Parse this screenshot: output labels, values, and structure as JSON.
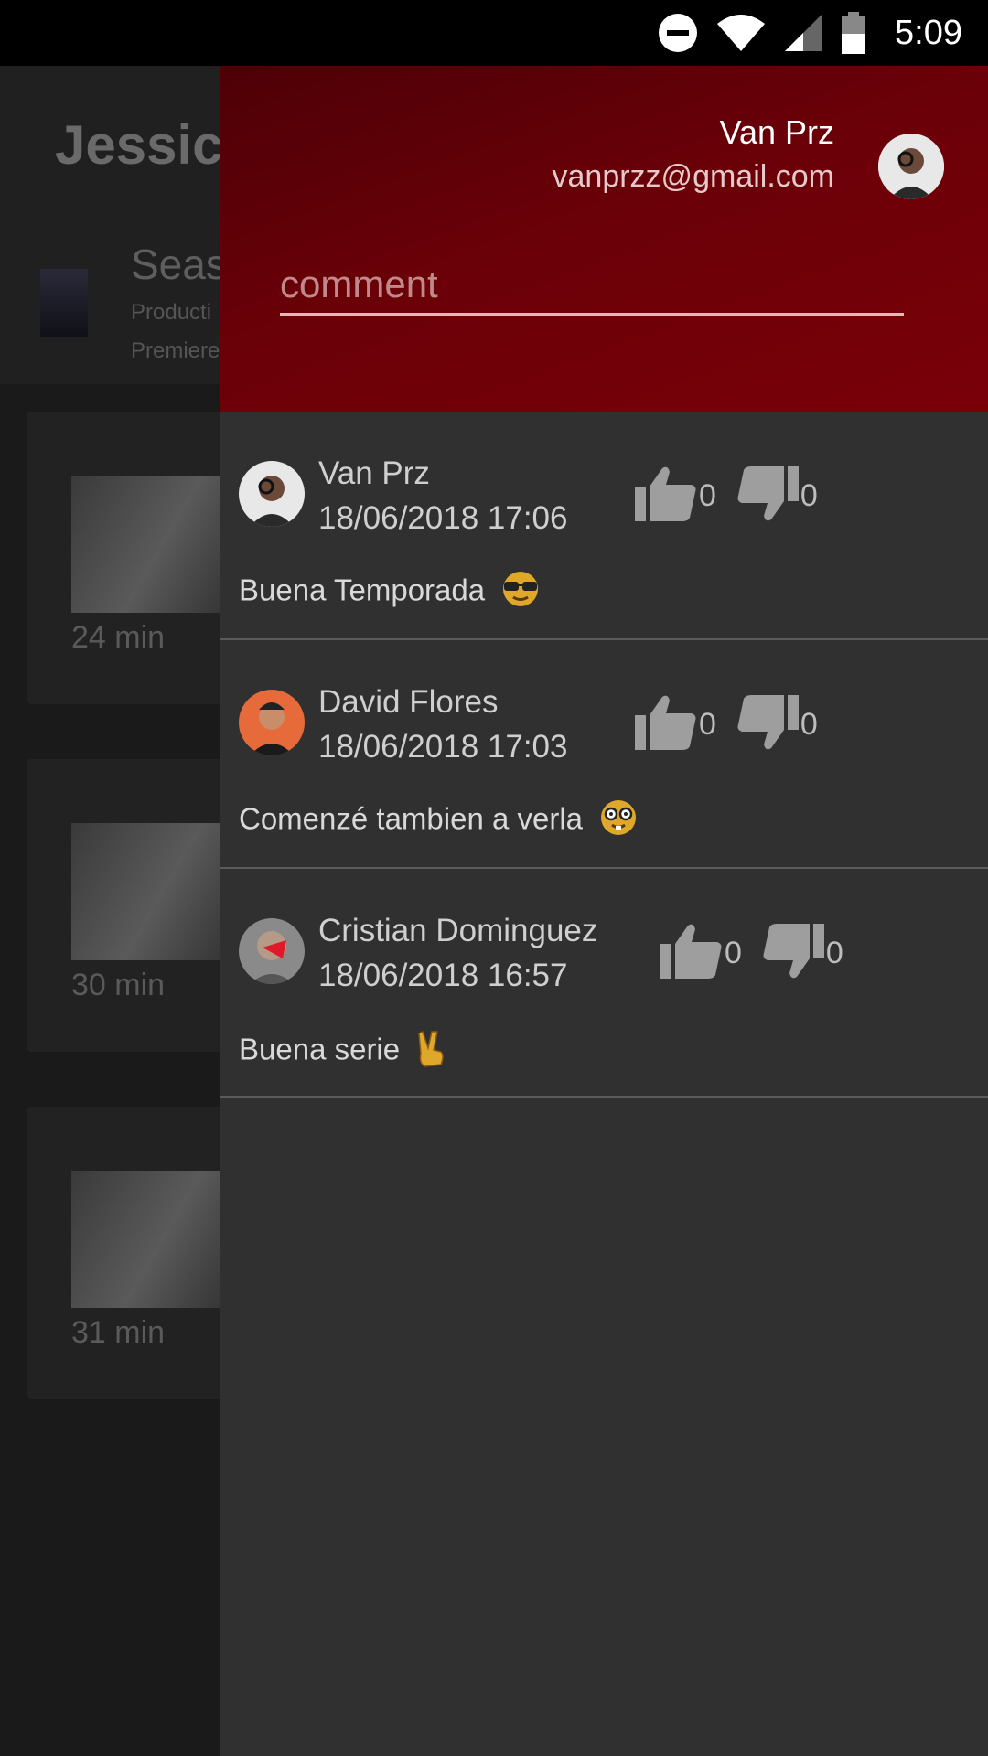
{
  "status_bar": {
    "time": "5:09"
  },
  "background_page": {
    "title": "Jessica",
    "season_label": "Seas",
    "season_line1": "Producti",
    "season_line2": "Premiere",
    "episodes": [
      {
        "duration": "24 min"
      },
      {
        "duration": "30 min"
      },
      {
        "duration": "31 min"
      }
    ]
  },
  "drawer": {
    "user": {
      "name": "Van Prz",
      "email": "vanprzz@gmail.com"
    },
    "comment_input": {
      "placeholder": "comment",
      "value": ""
    },
    "comments": [
      {
        "author": "Van Prz",
        "date": "18/06/2018 17:06",
        "text": "Buena Temporada",
        "emoji": "sunglasses",
        "likes": "0",
        "dislikes": "0"
      },
      {
        "author": "David Flores",
        "date": "18/06/2018 17:03",
        "text": "Comenzé tambien a verla",
        "emoji": "nerd-face",
        "likes": "0",
        "dislikes": "0"
      },
      {
        "author": "Cristian Dominguez",
        "date": "18/06/2018 16:57",
        "text": "Buena serie",
        "emoji": "victory-hand",
        "likes": "0",
        "dislikes": "0"
      }
    ]
  },
  "colors": {
    "header_red": "#6a0008",
    "drawer_bg": "#303030",
    "divider": "#5a5a5a"
  }
}
